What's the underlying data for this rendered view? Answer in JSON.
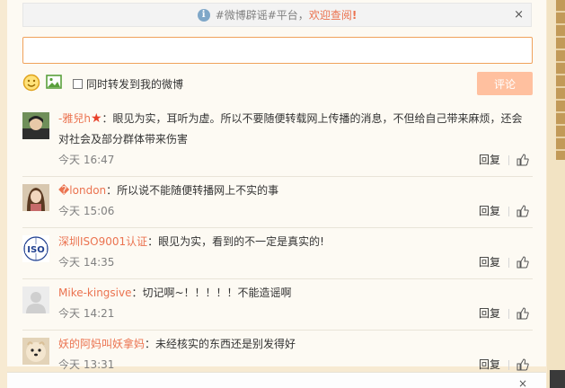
{
  "notice": {
    "tag_text": "#微博辟谣#平台，",
    "link_text": "欢迎查阅",
    "bang": "!",
    "close": "×"
  },
  "composer": {
    "input_value": "",
    "placeholder": "",
    "repost_label": "同时转发到我的微博",
    "submit_label": "评论"
  },
  "comments": [
    {
      "user": "-雅兒h",
      "badge": "★",
      "text": "：眼见为实，耳听为虚。所以不要随便转载网上传播的消息，不但给自己带来麻烦，还会对社会及部分群体带来伤害",
      "time": "今天 16:47",
      "reply": "回复"
    },
    {
      "user": "�london",
      "text": "：所以说不能随便转播网上不实的事",
      "time": "今天 15:06",
      "reply": "回复"
    },
    {
      "user": "深圳ISO9001认证",
      "text": "：眼见为实，看到的不一定是真实的!",
      "time": "今天 14:35",
      "reply": "回复",
      "avatar_text": "ISO"
    },
    {
      "user": "Mike-kingsive",
      "text": "：切记啊~！！！！！不能造谣啊",
      "time": "今天 14:21",
      "reply": "回复"
    },
    {
      "user": "妖的阿妈叫妖拿妈",
      "text": "：未经核实的东西还是别发得好",
      "time": "今天 13:31",
      "reply": "回复"
    }
  ],
  "next_panel": {
    "close": "×"
  },
  "colors": {
    "accent": "#eb7350",
    "submit_bg": "#ffc09f",
    "page_bg": "#f7ead2",
    "panel_bg": "#fdfaf3"
  }
}
